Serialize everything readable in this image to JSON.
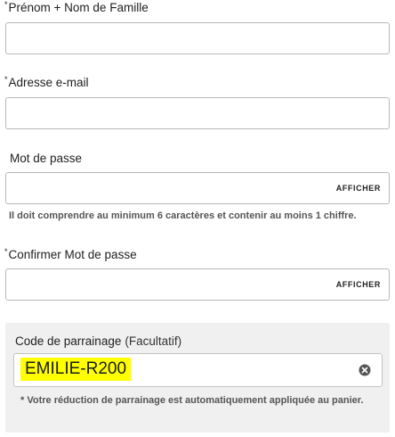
{
  "form": {
    "full_name": {
      "required_mark": "*",
      "label": "Prénom + Nom de Famille",
      "value": ""
    },
    "email": {
      "required_mark": "*",
      "label": "Adresse e-mail",
      "value": ""
    },
    "password": {
      "label": "Mot de passe",
      "value": "",
      "show_label": "AFFICHER",
      "hint": "Il doit comprendre au minimum 6 caractères et contenir au moins 1 chiffre."
    },
    "confirm_password": {
      "required_mark": "*",
      "label": "Confirmer Mot de passe",
      "value": "",
      "show_label": "AFFICHER"
    },
    "referral": {
      "label": "Code de parrainage",
      "optional": "(Facultatif)",
      "value": "EMILIE-R200",
      "highlight_color": "#ffff00",
      "clear_icon": "clear-circle-icon",
      "note": "* Votre réduction de parrainage est automatiquement appliquée au panier."
    }
  }
}
